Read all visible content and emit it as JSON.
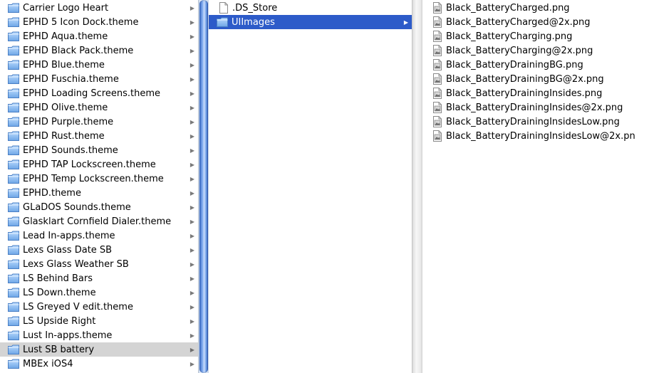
{
  "column1": {
    "items": [
      {
        "label": "Carrier Logo Heart"
      },
      {
        "label": "EPHD 5 Icon Dock.theme"
      },
      {
        "label": "EPHD Aqua.theme"
      },
      {
        "label": "EPHD Black Pack.theme"
      },
      {
        "label": "EPHD Blue.theme"
      },
      {
        "label": "EPHD Fuschia.theme"
      },
      {
        "label": "EPHD Loading Screens.theme"
      },
      {
        "label": "EPHD Olive.theme"
      },
      {
        "label": "EPHD Purple.theme"
      },
      {
        "label": "EPHD Rust.theme"
      },
      {
        "label": "EPHD Sounds.theme"
      },
      {
        "label": "EPHD TAP Lockscreen.theme"
      },
      {
        "label": "EPHD Temp Lockscreen.theme"
      },
      {
        "label": "EPHD.theme"
      },
      {
        "label": "GLaDOS Sounds.theme"
      },
      {
        "label": "Glasklart Cornfield Dialer.theme"
      },
      {
        "label": "Lead In-apps.theme"
      },
      {
        "label": "Lexs Glass Date SB"
      },
      {
        "label": "Lexs Glass Weather SB"
      },
      {
        "label": "LS Behind Bars"
      },
      {
        "label": "LS Down.theme"
      },
      {
        "label": "LS Greyed V edit.theme"
      },
      {
        "label": "LS Upside Right"
      },
      {
        "label": "Lust In-apps.theme"
      },
      {
        "label": "Lust SB battery",
        "selected": true
      },
      {
        "label": "MBEx iOS4"
      }
    ]
  },
  "column2": {
    "items": [
      {
        "label": ".DS_Store",
        "type": "document"
      },
      {
        "label": "UIImages",
        "type": "folder",
        "selected": true
      }
    ]
  },
  "column3": {
    "items": [
      {
        "label": "Black_BatteryCharged.png"
      },
      {
        "label": "Black_BatteryCharged@2x.png"
      },
      {
        "label": "Black_BatteryCharging.png"
      },
      {
        "label": "Black_BatteryCharging@2x.png"
      },
      {
        "label": "Black_BatteryDrainingBG.png"
      },
      {
        "label": "Black_BatteryDrainingBG@2x.png"
      },
      {
        "label": "Black_BatteryDrainingInsides.png"
      },
      {
        "label": "Black_BatteryDrainingInsides@2x.png"
      },
      {
        "label": "Black_BatteryDrainingInsidesLow.png"
      },
      {
        "label": "Black_BatteryDrainingInsidesLow@2x.pn"
      }
    ]
  },
  "icons": {
    "folder": "folder-icon",
    "document": "document-icon",
    "image_file": "image-file-icon",
    "disclosure": "chevron-right-icon"
  },
  "colors": {
    "selection_active": "#2d5bc9",
    "selection_inactive": "#d4d4d4",
    "folder_blue": "#7fb1ea"
  }
}
